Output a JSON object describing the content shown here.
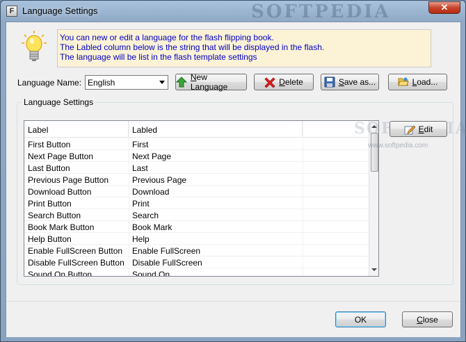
{
  "window": {
    "title": "Language Settings",
    "app_icon": "F",
    "watermark": "SOFTPEDIA",
    "close_glyph": "✕"
  },
  "info": {
    "lines": [
      "You can new or edit  a language for the flash flipping book.",
      "The Labled column below is the string that will be displayed in the flash.",
      "The language will be list in the flash template settings"
    ]
  },
  "language": {
    "label": "Language Name:",
    "selected": "English"
  },
  "toolbar": {
    "new_label": "New Language",
    "new_accel": "N",
    "delete_label": "Delete",
    "delete_accel": "D",
    "saveas_label": "Save as...",
    "saveas_accel": "S",
    "load_label": "Load...",
    "load_accel": "L"
  },
  "settings": {
    "group_title": "Language Settings",
    "edit_label": "Edit",
    "edit_accel": "E",
    "columns": [
      "Label",
      "Labled"
    ],
    "rows": [
      [
        "First Button",
        "First"
      ],
      [
        "Next Page Button",
        "Next Page"
      ],
      [
        "Last Button",
        "Last"
      ],
      [
        "Previous Page Button",
        "Previous Page"
      ],
      [
        "Download Button",
        "Download"
      ],
      [
        "Print Button",
        "Print"
      ],
      [
        "Search Button",
        "Search"
      ],
      [
        "Book Mark Button",
        "Book Mark"
      ],
      [
        "Help Button",
        "Help"
      ],
      [
        "Enable FullScreen Button",
        "Enable FullScreen"
      ],
      [
        "Disable FullScreen Button",
        "Disable FullScreen"
      ],
      [
        "Sound On Button",
        "Sound On"
      ]
    ],
    "watermark": "SOFTPEDIA",
    "watermark_url": "www.softpedia.com"
  },
  "footer": {
    "ok_label": "OK",
    "close_label": "Close",
    "close_accel": "C"
  },
  "colors": {
    "info_text": "#0000c8",
    "info_bg": "#fcf3d6",
    "close_red": "#c8442b"
  }
}
